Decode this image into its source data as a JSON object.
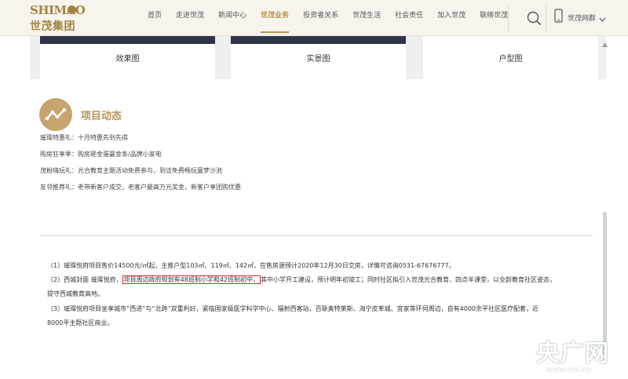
{
  "logo": {
    "en": "SHIMAO",
    "cn": "世茂集团"
  },
  "nav": {
    "items": [
      {
        "label": "首页",
        "active": false
      },
      {
        "label": "走进世茂",
        "active": false
      },
      {
        "label": "新闻中心",
        "active": false
      },
      {
        "label": "世茂业务",
        "active": true
      },
      {
        "label": "投资者关系",
        "active": false
      },
      {
        "label": "世茂生活",
        "active": false
      },
      {
        "label": "社会责任",
        "active": false
      },
      {
        "label": "加入世茂",
        "active": false
      },
      {
        "label": "联络世茂",
        "active": false
      }
    ],
    "search_icon": "search-icon",
    "phone_label": "世茂网群",
    "phone_icon": "mobile-phone-icon"
  },
  "cards": [
    {
      "label": "效果图"
    },
    {
      "label": "实景图"
    },
    {
      "label": "户型图"
    }
  ],
  "section": {
    "icon": "trend-line-icon",
    "title": "项目动态",
    "promos": [
      "璀璨特惠礼：十月特惠先到先得",
      "购房狂享季：购房砸金蛋赢金条/品牌小家电",
      "茂粉嗨玩礼：光合教育主题活动免费参与，到访免费畅玩童梦沙池",
      "友邻推荐礼：老带新客户成交，老客户最高万元奖金，新客户享团购优惠"
    ],
    "notes": {
      "line1": "（1）璀璨悦府项目售价14500元/㎡起，主推户型103㎡、119㎡、142㎡，在售房源预计2020年12月30日交房，详情可咨询0531-67676777。",
      "line2_pre": "（2）西城封面 璀璨悦府，",
      "line2_highlight": "项目周边政府规划有48班制小学和42班制初中，",
      "line2_post": "其中小学开工建设，预计明年初竣工；同时社区拟引入世茂光合教育、四点半课堂，以全龄教育社区姿态，",
      "line3": "提守西城教育高地。",
      "line4": "（3）璀璨悦府项目坐享城市“西进”与“北跨”双重利好，紧临国家级医学科学中心、辐射西客站，百联奥特莱斯、海宁皮革城、宜家等环伺周边，自有4000余平社区医疗配套，近",
      "line5": "8000平主题社区商业。"
    }
  },
  "watermark": {
    "cn": "央广网",
    "url": "www.cnr.cn"
  }
}
